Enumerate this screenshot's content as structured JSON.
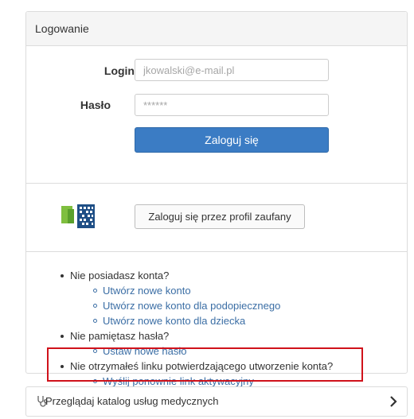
{
  "login_panel": {
    "header_title": "Logowanie",
    "login_label": "Login",
    "login_placeholder": "jkowalski@e-mail.pl",
    "password_label": "Hasło",
    "password_placeholder": "******",
    "submit_label": "Zaloguj się"
  },
  "trusted_profile": {
    "button_label": "Zaloguj się przez profil zaufany"
  },
  "help": {
    "no_account": "Nie posiadasz konta?",
    "no_account_links": [
      "Utwórz nowe konto",
      "Utwórz nowe konto dla podopiecznego",
      "Utwórz nowe konto dla dziecka"
    ],
    "forgot_password": "Nie pamiętasz hasła?",
    "forgot_password_link": "Ustaw nowe hasło",
    "no_activation": "Nie otrzymałeś linku potwierdzającego utworzenie konta?",
    "resend_link": "Wyślij ponownie link aktywacyjny"
  },
  "catalog": {
    "label": "Przeglądaj katalog usług medycznych",
    "icon": "stethoscope-icon",
    "arrow_icon": "chevron-right-icon"
  },
  "colors": {
    "primary": "#3b7cc4",
    "link": "#3b6ea5",
    "highlight": "#d0121b"
  }
}
